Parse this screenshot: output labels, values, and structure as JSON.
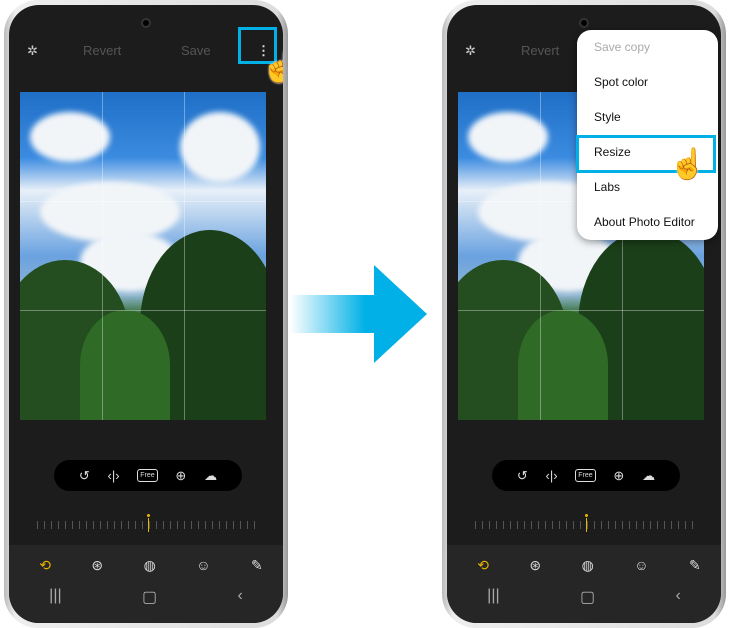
{
  "colors": {
    "highlight": "#00b0e6",
    "accent": "#e8b400"
  },
  "left": {
    "topbar": {
      "revert": "Revert",
      "save": "Save"
    },
    "crop_tools": {
      "free": "Free"
    }
  },
  "right": {
    "topbar": {
      "revert": "Revert"
    },
    "crop_tools": {
      "free": "Free"
    },
    "menu": {
      "items": [
        "Save copy",
        "Spot color",
        "Style",
        "Resize",
        "Labs",
        "About Photo Editor"
      ]
    }
  }
}
